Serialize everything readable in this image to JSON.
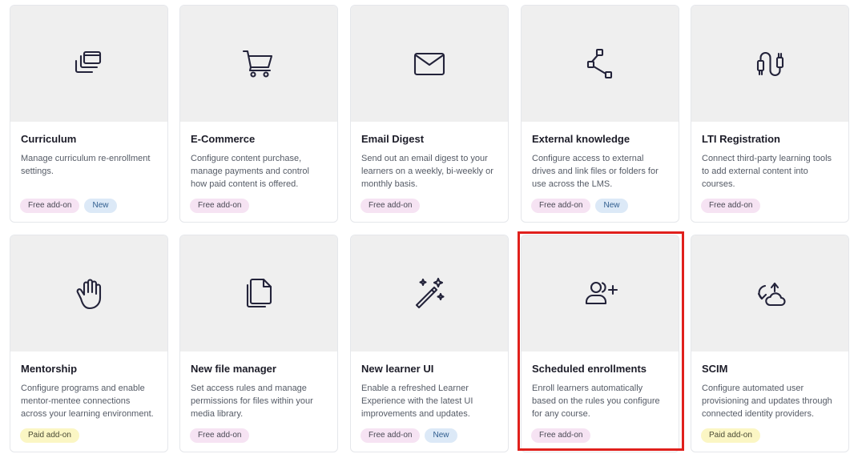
{
  "cards": [
    {
      "title": "Curriculum",
      "desc": "Manage curriculum re-enrollment settings.",
      "icon": "layers-icon",
      "badges": [
        {
          "label": "Free add-on",
          "kind": "free"
        },
        {
          "label": "New",
          "kind": "new"
        }
      ]
    },
    {
      "title": "E-Commerce",
      "desc": "Configure content purchase, manage payments and control how paid content is offered.",
      "icon": "cart-icon",
      "badges": [
        {
          "label": "Free add-on",
          "kind": "free"
        }
      ]
    },
    {
      "title": "Email Digest",
      "desc": "Send out an email digest to your learners on a weekly, bi-weekly or monthly basis.",
      "icon": "mail-icon",
      "badges": [
        {
          "label": "Free add-on",
          "kind": "free"
        }
      ]
    },
    {
      "title": "External knowledge",
      "desc": "Configure access to external drives and link files or folders for use across the LMS.",
      "icon": "share-nodes-icon",
      "badges": [
        {
          "label": "Free add-on",
          "kind": "free"
        },
        {
          "label": "New",
          "kind": "new"
        }
      ]
    },
    {
      "title": "LTI Registration",
      "desc": "Connect third-party learning tools to add external content into courses.",
      "icon": "plug-icon",
      "badges": [
        {
          "label": "Free add-on",
          "kind": "free"
        }
      ]
    },
    {
      "title": "Mentorship",
      "desc": "Configure programs and enable mentor-mentee connections across your learning environment.",
      "icon": "waving-hand-icon",
      "badges": [
        {
          "label": "Paid add-on",
          "kind": "paid"
        }
      ]
    },
    {
      "title": "New file manager",
      "desc": "Set access rules and manage permissions for files within your media library.",
      "icon": "files-icon",
      "badges": [
        {
          "label": "Free add-on",
          "kind": "free"
        }
      ]
    },
    {
      "title": "New learner UI",
      "desc": "Enable a refreshed Learner Experience with the latest UI improvements and updates.",
      "icon": "magic-wand-icon",
      "badges": [
        {
          "label": "Free add-on",
          "kind": "free"
        },
        {
          "label": "New",
          "kind": "new"
        }
      ]
    },
    {
      "title": "Scheduled enrollments",
      "desc": "Enroll learners automatically based on the rules you configure for any course.",
      "icon": "users-plus-icon",
      "badges": [
        {
          "label": "Free add-on",
          "kind": "free"
        }
      ]
    },
    {
      "title": "SCIM",
      "desc": "Configure automated user provisioning and updates through connected identity providers.",
      "icon": "cloud-sync-icon",
      "badges": [
        {
          "label": "Paid add-on",
          "kind": "paid"
        }
      ]
    }
  ],
  "colors": {
    "highlight": "#e0201c",
    "free_badge": "#f6e3f3",
    "new_badge": "#dce9f7",
    "paid_badge": "#fbf6c4"
  }
}
